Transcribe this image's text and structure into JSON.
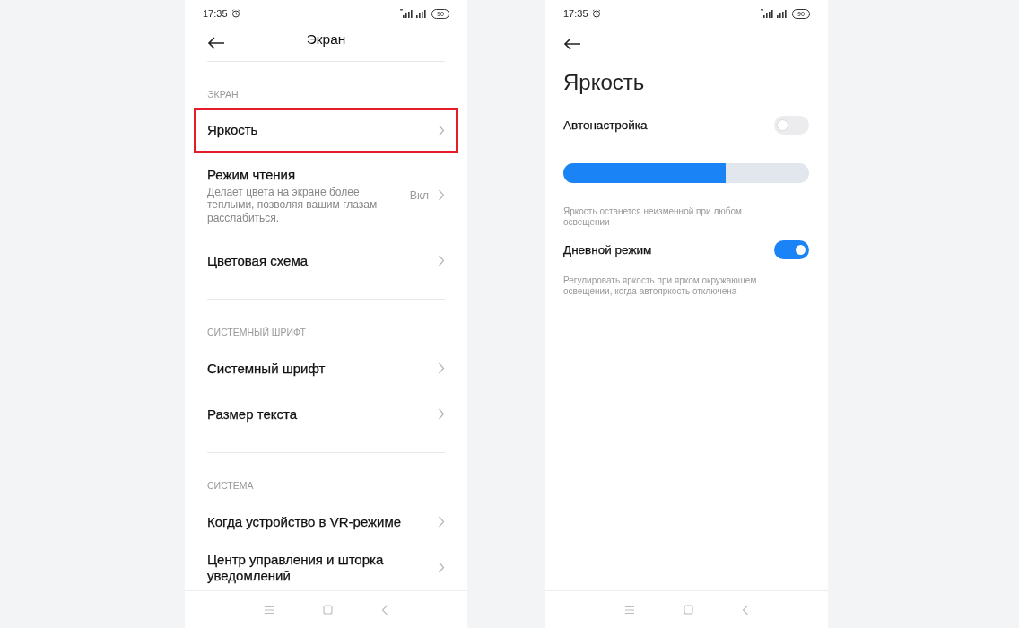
{
  "display_screen": {
    "status_bar": {
      "time": "17:35",
      "battery": "90"
    },
    "title": "Экран",
    "sections": [
      {
        "heading": "ЭКРАН",
        "items": [
          {
            "title": "Яркость",
            "highlighted": true
          },
          {
            "title": "Режим чтения",
            "description": "Делает цвета на экране более теплыми, позволяя вашим глазам расслабиться.",
            "value": "Вкл",
            "highlighted": false
          },
          {
            "title": "Цветовая схема",
            "highlighted": false
          }
        ]
      },
      {
        "heading": "СИСТЕМНЫЙ ШРИФТ",
        "items": [
          {
            "title": "Системный шрифт",
            "highlighted": false
          },
          {
            "title": "Размер текста",
            "highlighted": false
          }
        ]
      },
      {
        "heading": "СИСТЕМА",
        "items": [
          {
            "title": "Когда устройство в VR-режиме",
            "highlighted": false
          },
          {
            "title": "Центр управления и шторка уведомлений",
            "highlighted": false
          }
        ]
      }
    ]
  },
  "brightness_screen": {
    "status_bar": {
      "time": "17:35",
      "battery": "90"
    },
    "title": "Яркость",
    "auto_brightness": {
      "label": "Автонастройка",
      "on": false
    },
    "slider": {
      "level": 0.66
    },
    "slider_note": "Яркость останется неизменной при любом освещении",
    "day_mode": {
      "label": "Дневной режим",
      "on": true
    },
    "day_mode_note": "Регулировать яркость при ярком окружающем освещении, когда автояркость отключена"
  }
}
